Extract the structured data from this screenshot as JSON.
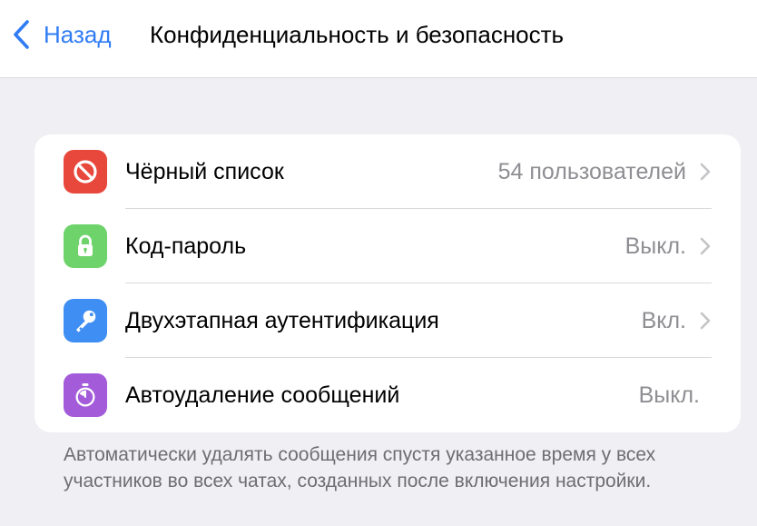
{
  "navbar": {
    "back_label": "Назад",
    "title": "Конфиденциальность и безопасность"
  },
  "settings": {
    "rows": [
      {
        "label": "Чёрный список",
        "value": "54 пользователей",
        "icon": "block-icon",
        "icon_color": "#E8473C",
        "has_chevron": true
      },
      {
        "label": "Код-пароль",
        "value": "Выкл.",
        "icon": "lock-icon",
        "icon_color": "#6DD36A",
        "has_chevron": true
      },
      {
        "label": "Двухэтапная аутентификация",
        "value": "Вкл.",
        "icon": "key-icon",
        "icon_color": "#3E8EF3",
        "has_chevron": true
      },
      {
        "label": "Автоудаление сообщений",
        "value": "Выкл.",
        "icon": "timer-icon",
        "icon_color": "#A35BD9",
        "has_chevron": false
      }
    ]
  },
  "footer": {
    "note": "Автоматически удалять сообщения спустя указанное время у всех участников во всех чатах, созданных после включения настройки."
  },
  "colors": {
    "accent": "#2F7CF6",
    "background": "#EFEFF4",
    "secondary_text": "#8E8E93"
  }
}
